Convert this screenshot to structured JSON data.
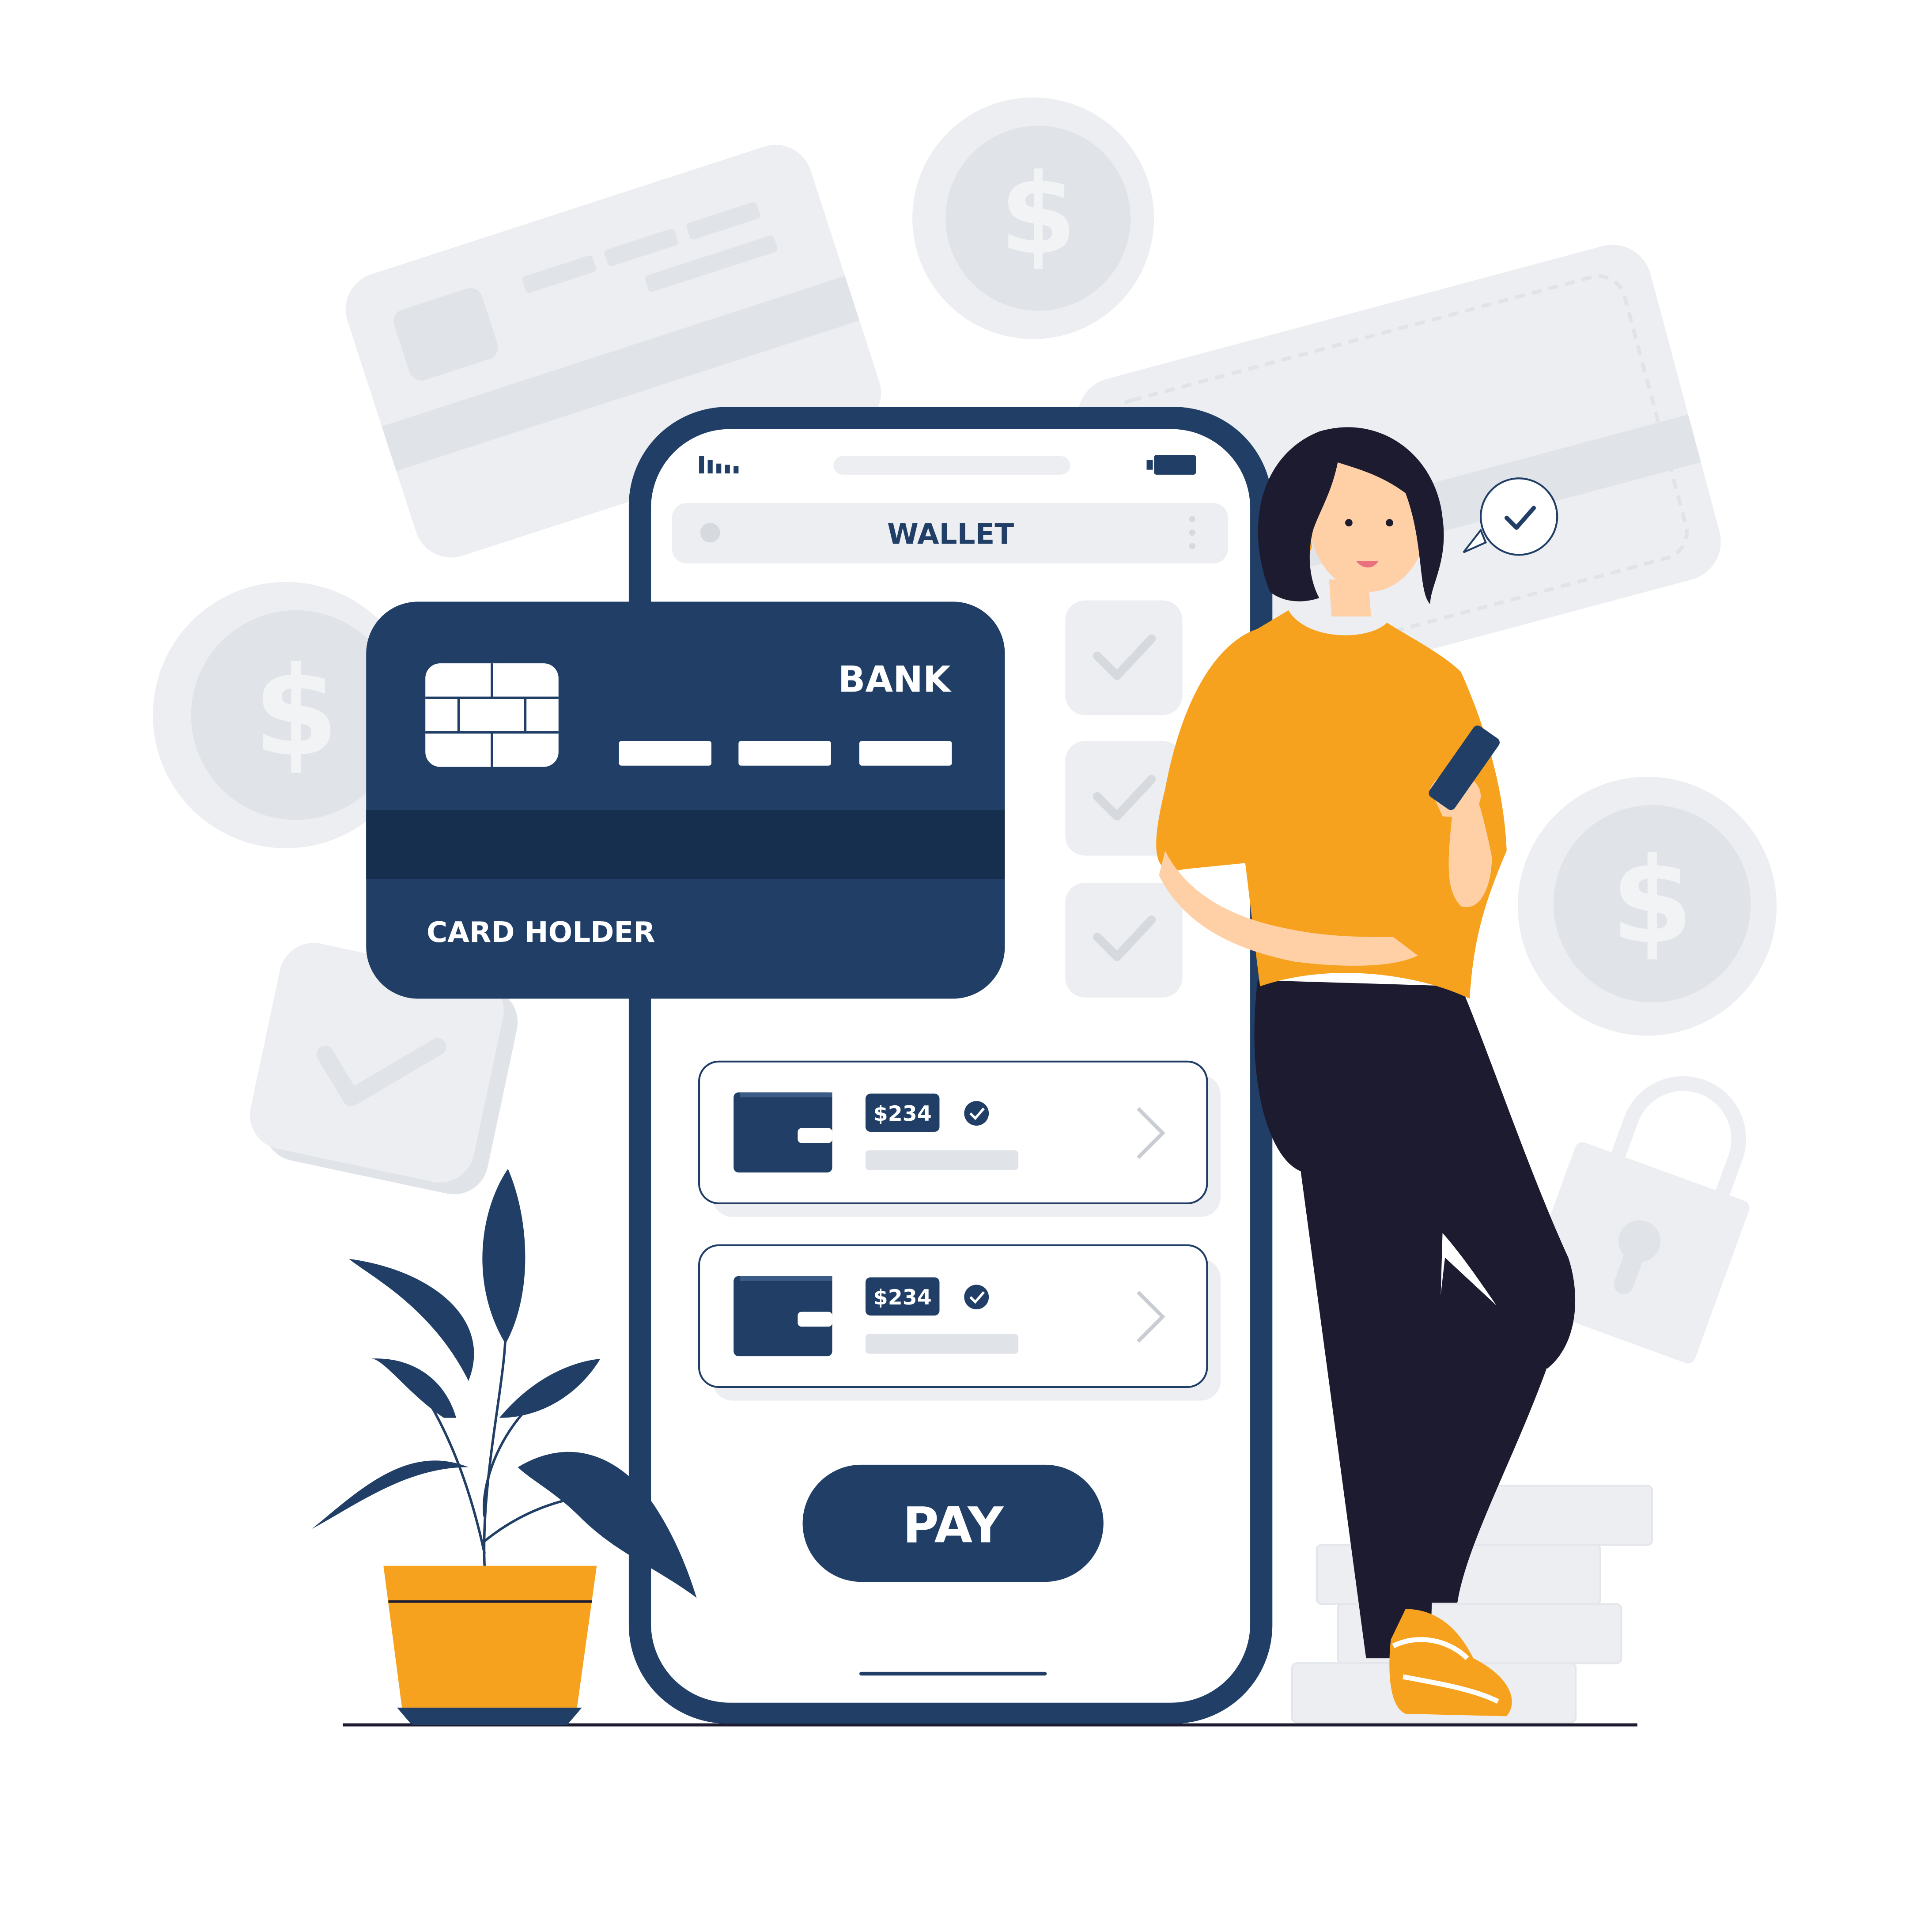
{
  "colors": {
    "navy": "#213f66",
    "navy_dark": "#162f4f",
    "orange": "#f7a21e",
    "skin": "#ffcfa6",
    "hair": "#1c1b2f",
    "pants": "#1c1b2f",
    "light_gray": "#eceef1",
    "mid_gray": "#e0e3e7",
    "white": "#ffffff"
  },
  "phone": {
    "header_title": "WALLET",
    "pay_button_label": "PAY",
    "signal_icon": "signal-bars-icon",
    "battery_icon": "battery-icon",
    "menu_icon": "kebab-menu-icon"
  },
  "bank_card": {
    "bank_name": "BANK",
    "holder_label": "CARD HOLDER",
    "chip_icon": "card-chip-icon"
  },
  "wallet_items": [
    {
      "amount": "$234",
      "icon": "wallet-icon",
      "verified_icon": "check-badge-icon",
      "arrow_icon": "chevron-right-icon"
    },
    {
      "amount": "$234",
      "icon": "wallet-icon",
      "verified_icon": "check-badge-icon",
      "arrow_icon": "chevron-right-icon"
    }
  ],
  "side_checks": [
    {
      "icon": "checkmark-icon"
    },
    {
      "icon": "checkmark-icon"
    },
    {
      "icon": "checkmark-icon"
    }
  ],
  "background": {
    "coin_icon": "dollar-coin-icon",
    "card_icon": "credit-card-icon",
    "lock_icon": "padlock-icon",
    "check_tile_icon": "checkmark-icon"
  }
}
